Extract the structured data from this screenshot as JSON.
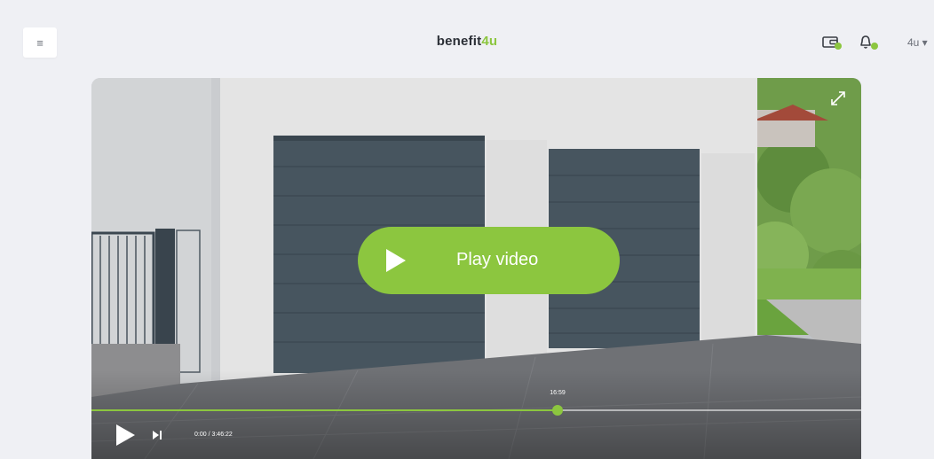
{
  "header": {
    "menu_icon": "hamburger-icon",
    "logo": {
      "part1": "benefit",
      "part2": "4u"
    },
    "wallet_icon": "wallet-icon",
    "bell_icon": "bell-icon",
    "language": "4u ▾"
  },
  "video": {
    "play_label": "Play video",
    "expand_icon": "expand-icon",
    "hover_time": "16:59",
    "current_time": "0:00 / 3:46:22",
    "progress": 0.605
  },
  "colors": {
    "accent": "#8cc63f",
    "background": "#eff0f4",
    "text_dark": "#2b2f36"
  }
}
